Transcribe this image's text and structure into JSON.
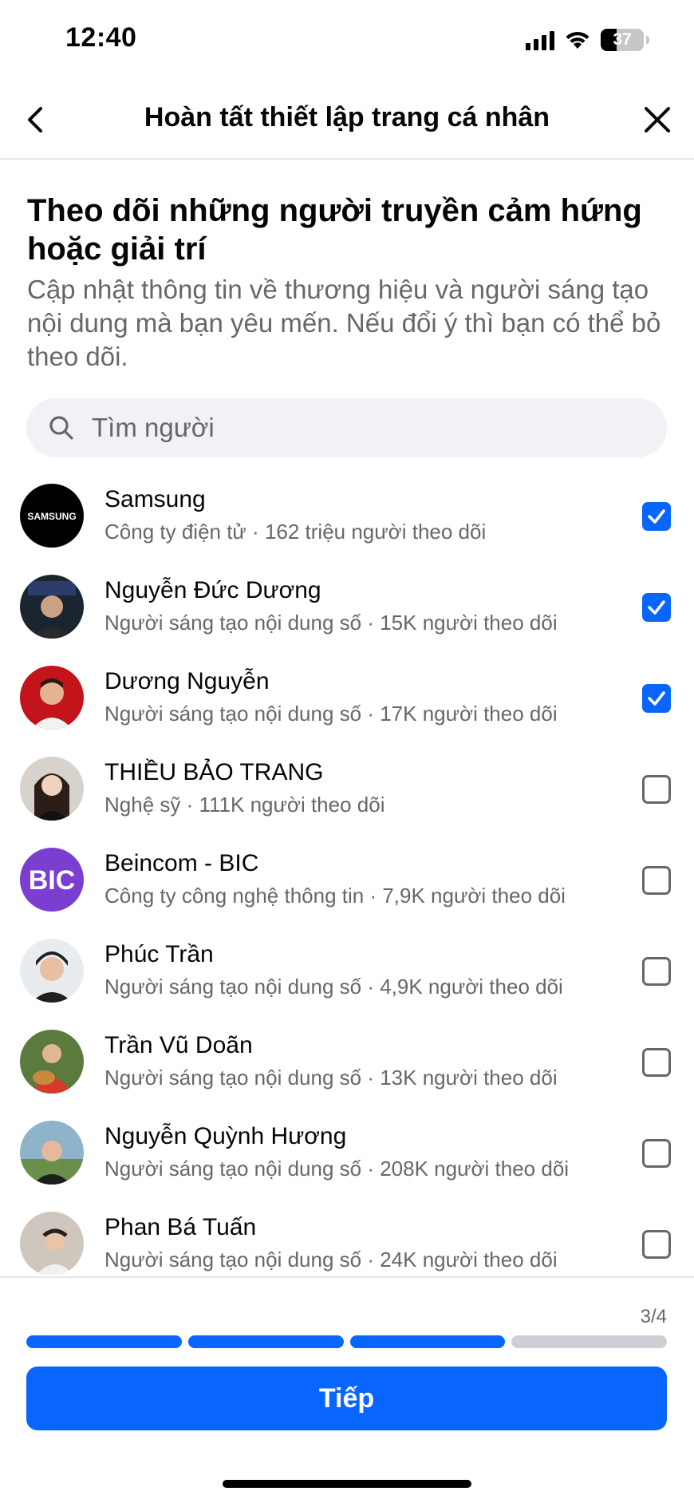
{
  "status_bar": {
    "time": "12:40",
    "battery": "37"
  },
  "nav": {
    "title": "Hoàn tất thiết lập trang cá nhân"
  },
  "heading": "Theo dõi những người truyền cảm hứng hoặc giải trí",
  "subtext": "Cập nhật thông tin về thương hiệu và người sáng tạo nội dung mà bạn yêu mến. Nếu đổi ý thì bạn có thể bỏ theo dõi.",
  "search": {
    "placeholder": "Tìm người"
  },
  "people": [
    {
      "name": "Samsung",
      "meta": "Công ty điện tử · 162 triệu người theo dõi",
      "checked": true,
      "avatar": "samsung-logo",
      "avatar_text": "SAMSUNG"
    },
    {
      "name": "Nguyễn Đức Dương",
      "meta": "Người sáng tạo nội dung số · 15K người theo dõi",
      "checked": true,
      "avatar": "photo"
    },
    {
      "name": "Dương Nguyễn",
      "meta": "Người sáng tạo nội dung số · 17K người theo dõi",
      "checked": true,
      "avatar": "photo"
    },
    {
      "name": "THIỀU BẢO TRANG",
      "meta": "Nghệ sỹ · 111K người theo dõi",
      "checked": false,
      "avatar": "photo"
    },
    {
      "name": "Beincom - BIC",
      "meta": "Công ty công nghệ thông tin · 7,9K người theo dõi",
      "checked": false,
      "avatar": "bic-logo",
      "avatar_text": "BIC"
    },
    {
      "name": "Phúc Trần",
      "meta": "Người sáng tạo nội dung số · 4,9K người theo dõi",
      "checked": false,
      "avatar": "photo"
    },
    {
      "name": "Trần Vũ Doãn",
      "meta": "Người sáng tạo nội dung số · 13K người theo dõi",
      "checked": false,
      "avatar": "photo"
    },
    {
      "name": "Nguyễn Quỳnh Hương",
      "meta": "Người sáng tạo nội dung số · 208K người theo dõi",
      "checked": false,
      "avatar": "photo"
    },
    {
      "name": "Phan Bá Tuấn",
      "meta": "Người sáng tạo nội dung số · 24K người theo dõi",
      "checked": false,
      "avatar": "photo"
    }
  ],
  "progress": {
    "step_label": "3/4",
    "completed": 3,
    "total": 4
  },
  "next_button": {
    "label": "Tiếp"
  },
  "colors": {
    "accent": "#0866ff",
    "secondary_text": "#65676b",
    "inactive": "#ccd0d5"
  }
}
